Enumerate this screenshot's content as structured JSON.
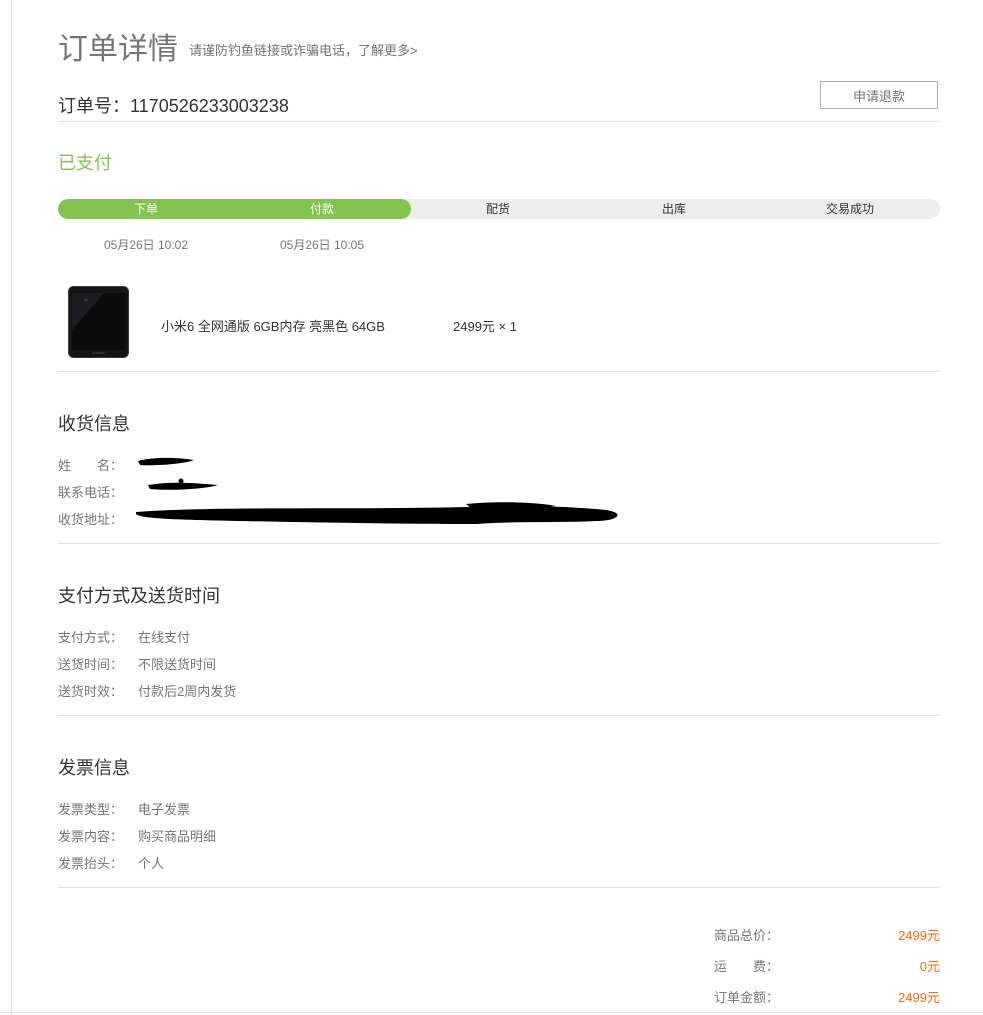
{
  "header": {
    "title": "订单详情",
    "notice": "请谨防钓鱼链接或诈骗电话，了解更多>"
  },
  "order": {
    "number_label": "订单号：1170526233003238",
    "refund_button": "申请退款",
    "status": "已支付"
  },
  "progress": {
    "completed_steps": 2,
    "steps": [
      {
        "label": "下单",
        "time": "05月26日 10:02"
      },
      {
        "label": "付款",
        "time": "05月26日 10:05"
      },
      {
        "label": "配货",
        "time": ""
      },
      {
        "label": "出库",
        "time": ""
      },
      {
        "label": "交易成功",
        "time": ""
      }
    ]
  },
  "product": {
    "name": "小米6 全网通版 6GB内存 亮黑色 64GB",
    "price_qty": "2499元 × 1"
  },
  "shipping": {
    "title": "收货信息",
    "name_label": "姓　　名：",
    "phone_label": "联系电话：",
    "address_label": "收货地址："
  },
  "payment": {
    "title": "支付方式及送货时间",
    "rows": [
      {
        "label": "支付方式：",
        "value": "在线支付"
      },
      {
        "label": "送货时间：",
        "value": "不限送货时间"
      },
      {
        "label": "送货时效：",
        "value": "付款后2周内发货"
      }
    ]
  },
  "invoice": {
    "title": "发票信息",
    "rows": [
      {
        "label": "发票类型：",
        "value": "电子发票"
      },
      {
        "label": "发票内容：",
        "value": "购买商品明细"
      },
      {
        "label": "发票抬头：",
        "value": "个人"
      }
    ]
  },
  "summary": {
    "rows": [
      {
        "label": "商品总价：",
        "amount": "2499元"
      },
      {
        "label": "运　　费：",
        "amount": "0元"
      },
      {
        "label": "订单金额：",
        "amount": "2499元"
      }
    ]
  },
  "colors": {
    "accent_green": "#83c44e",
    "price_orange": "#ff6700"
  }
}
